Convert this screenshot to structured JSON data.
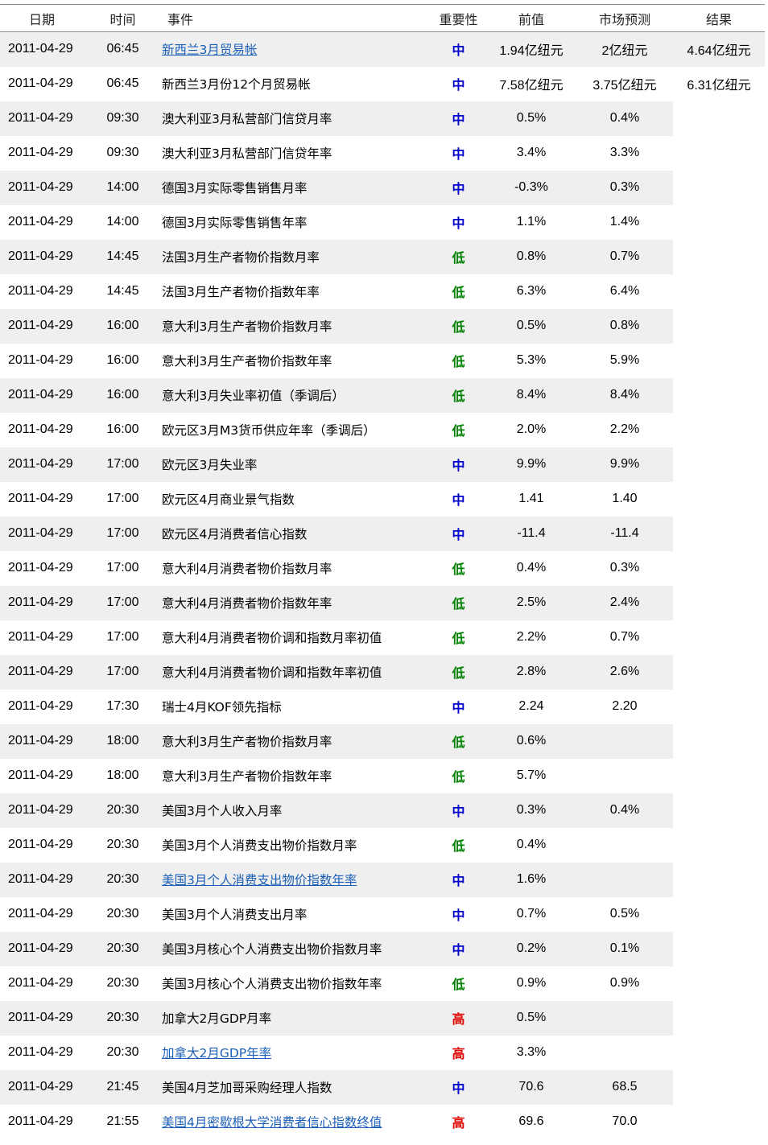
{
  "headers": {
    "date": "日期",
    "time": "时间",
    "event": "事件",
    "importance": "重要性",
    "previous": "前值",
    "forecast": "市场预测",
    "result": "结果"
  },
  "colors": {
    "link": "#1b5fb8",
    "importance_mid": "#0000cc",
    "importance_low": "#008000",
    "importance_high": "#e00000",
    "row_shade": "#efefef"
  },
  "rows": [
    {
      "date": "2011-04-29",
      "time": "06:45",
      "event": "新西兰3月贸易帐",
      "link": true,
      "importance": "中",
      "level": "mid",
      "previous": "1.94亿纽元",
      "forecast": "2亿纽元",
      "result": "4.64亿纽元"
    },
    {
      "date": "2011-04-29",
      "time": "06:45",
      "event": "新西兰3月份12个月贸易帐",
      "link": false,
      "importance": "中",
      "level": "mid",
      "previous": "7.58亿纽元",
      "forecast": "3.75亿纽元",
      "result": "6.31亿纽元"
    },
    {
      "date": "2011-04-29",
      "time": "09:30",
      "event": "澳大利亚3月私营部门信贷月率",
      "link": false,
      "importance": "中",
      "level": "mid",
      "previous": "0.5%",
      "forecast": "0.4%",
      "result": ""
    },
    {
      "date": "2011-04-29",
      "time": "09:30",
      "event": "澳大利亚3月私营部门信贷年率",
      "link": false,
      "importance": "中",
      "level": "mid",
      "previous": "3.4%",
      "forecast": "3.3%",
      "result": ""
    },
    {
      "date": "2011-04-29",
      "time": "14:00",
      "event": "德国3月实际零售销售月率",
      "link": false,
      "importance": "中",
      "level": "mid",
      "previous": "-0.3%",
      "forecast": "0.3%",
      "result": ""
    },
    {
      "date": "2011-04-29",
      "time": "14:00",
      "event": "德国3月实际零售销售年率",
      "link": false,
      "importance": "中",
      "level": "mid",
      "previous": "1.1%",
      "forecast": "1.4%",
      "result": ""
    },
    {
      "date": "2011-04-29",
      "time": "14:45",
      "event": "法国3月生产者物价指数月率",
      "link": false,
      "importance": "低",
      "level": "low",
      "previous": "0.8%",
      "forecast": "0.7%",
      "result": ""
    },
    {
      "date": "2011-04-29",
      "time": "14:45",
      "event": "法国3月生产者物价指数年率",
      "link": false,
      "importance": "低",
      "level": "low",
      "previous": "6.3%",
      "forecast": "6.4%",
      "result": ""
    },
    {
      "date": "2011-04-29",
      "time": "16:00",
      "event": "意大利3月生产者物价指数月率",
      "link": false,
      "importance": "低",
      "level": "low",
      "previous": "0.5%",
      "forecast": "0.8%",
      "result": ""
    },
    {
      "date": "2011-04-29",
      "time": "16:00",
      "event": "意大利3月生产者物价指数年率",
      "link": false,
      "importance": "低",
      "level": "low",
      "previous": "5.3%",
      "forecast": "5.9%",
      "result": ""
    },
    {
      "date": "2011-04-29",
      "time": "16:00",
      "event": "意大利3月失业率初值（季调后）",
      "link": false,
      "importance": "低",
      "level": "low",
      "previous": "8.4%",
      "forecast": "8.4%",
      "result": ""
    },
    {
      "date": "2011-04-29",
      "time": "16:00",
      "event": "欧元区3月M3货币供应年率（季调后）",
      "link": false,
      "importance": "低",
      "level": "low",
      "previous": "2.0%",
      "forecast": "2.2%",
      "result": ""
    },
    {
      "date": "2011-04-29",
      "time": "17:00",
      "event": "欧元区3月失业率",
      "link": false,
      "importance": "中",
      "level": "mid",
      "previous": "9.9%",
      "forecast": "9.9%",
      "result": ""
    },
    {
      "date": "2011-04-29",
      "time": "17:00",
      "event": "欧元区4月商业景气指数",
      "link": false,
      "importance": "中",
      "level": "mid",
      "previous": "1.41",
      "forecast": "1.40",
      "result": ""
    },
    {
      "date": "2011-04-29",
      "time": "17:00",
      "event": "欧元区4月消费者信心指数",
      "link": false,
      "importance": "中",
      "level": "mid",
      "previous": "-11.4",
      "forecast": "-11.4",
      "result": ""
    },
    {
      "date": "2011-04-29",
      "time": "17:00",
      "event": "意大利4月消费者物价指数月率",
      "link": false,
      "importance": "低",
      "level": "low",
      "previous": "0.4%",
      "forecast": "0.3%",
      "result": ""
    },
    {
      "date": "2011-04-29",
      "time": "17:00",
      "event": "意大利4月消费者物价指数年率",
      "link": false,
      "importance": "低",
      "level": "low",
      "previous": "2.5%",
      "forecast": "2.4%",
      "result": ""
    },
    {
      "date": "2011-04-29",
      "time": "17:00",
      "event": "意大利4月消费者物价调和指数月率初值",
      "link": false,
      "importance": "低",
      "level": "low",
      "previous": "2.2%",
      "forecast": "0.7%",
      "result": ""
    },
    {
      "date": "2011-04-29",
      "time": "17:00",
      "event": "意大利4月消费者物价调和指数年率初值",
      "link": false,
      "importance": "低",
      "level": "low",
      "previous": "2.8%",
      "forecast": "2.6%",
      "result": ""
    },
    {
      "date": "2011-04-29",
      "time": "17:30",
      "event": "瑞士4月KOF领先指标",
      "link": false,
      "importance": "中",
      "level": "mid",
      "previous": "2.24",
      "forecast": "2.20",
      "result": ""
    },
    {
      "date": "2011-04-29",
      "time": "18:00",
      "event": "意大利3月生产者物价指数月率",
      "link": false,
      "importance": "低",
      "level": "low",
      "previous": "0.6%",
      "forecast": "",
      "result": ""
    },
    {
      "date": "2011-04-29",
      "time": "18:00",
      "event": "意大利3月生产者物价指数年率",
      "link": false,
      "importance": "低",
      "level": "low",
      "previous": "5.7%",
      "forecast": "",
      "result": ""
    },
    {
      "date": "2011-04-29",
      "time": "20:30",
      "event": "美国3月个人收入月率",
      "link": false,
      "importance": "中",
      "level": "mid",
      "previous": "0.3%",
      "forecast": "0.4%",
      "result": ""
    },
    {
      "date": "2011-04-29",
      "time": "20:30",
      "event": "美国3月个人消费支出物价指数月率",
      "link": false,
      "importance": "低",
      "level": "low",
      "previous": "0.4%",
      "forecast": "",
      "result": ""
    },
    {
      "date": "2011-04-29",
      "time": "20:30",
      "event": "美国3月个人消费支出物价指数年率",
      "link": true,
      "importance": "中",
      "level": "mid",
      "previous": "1.6%",
      "forecast": "",
      "result": ""
    },
    {
      "date": "2011-04-29",
      "time": "20:30",
      "event": "美国3月个人消费支出月率",
      "link": false,
      "importance": "中",
      "level": "mid",
      "previous": "0.7%",
      "forecast": "0.5%",
      "result": ""
    },
    {
      "date": "2011-04-29",
      "time": "20:30",
      "event": "美国3月核心个人消费支出物价指数月率",
      "link": false,
      "importance": "中",
      "level": "mid",
      "previous": "0.2%",
      "forecast": "0.1%",
      "result": ""
    },
    {
      "date": "2011-04-29",
      "time": "20:30",
      "event": "美国3月核心个人消费支出物价指数年率",
      "link": false,
      "importance": "低",
      "level": "low",
      "previous": "0.9%",
      "forecast": "0.9%",
      "result": ""
    },
    {
      "date": "2011-04-29",
      "time": "20:30",
      "event": "加拿大2月GDP月率",
      "link": false,
      "importance": "高",
      "level": "high",
      "previous": "0.5%",
      "forecast": "",
      "result": ""
    },
    {
      "date": "2011-04-29",
      "time": "20:30",
      "event": "加拿大2月GDP年率",
      "link": true,
      "importance": "高",
      "level": "high",
      "previous": "3.3%",
      "forecast": "",
      "result": ""
    },
    {
      "date": "2011-04-29",
      "time": "21:45",
      "event": "美国4月芝加哥采购经理人指数",
      "link": false,
      "importance": "中",
      "level": "mid",
      "previous": "70.6",
      "forecast": "68.5",
      "result": ""
    },
    {
      "date": "2011-04-29",
      "time": "21:55",
      "event": "美国4月密歇根大学消费者信心指数终值",
      "link": true,
      "importance": "高",
      "level": "high",
      "previous": "69.6",
      "forecast": "70.0",
      "result": ""
    }
  ]
}
